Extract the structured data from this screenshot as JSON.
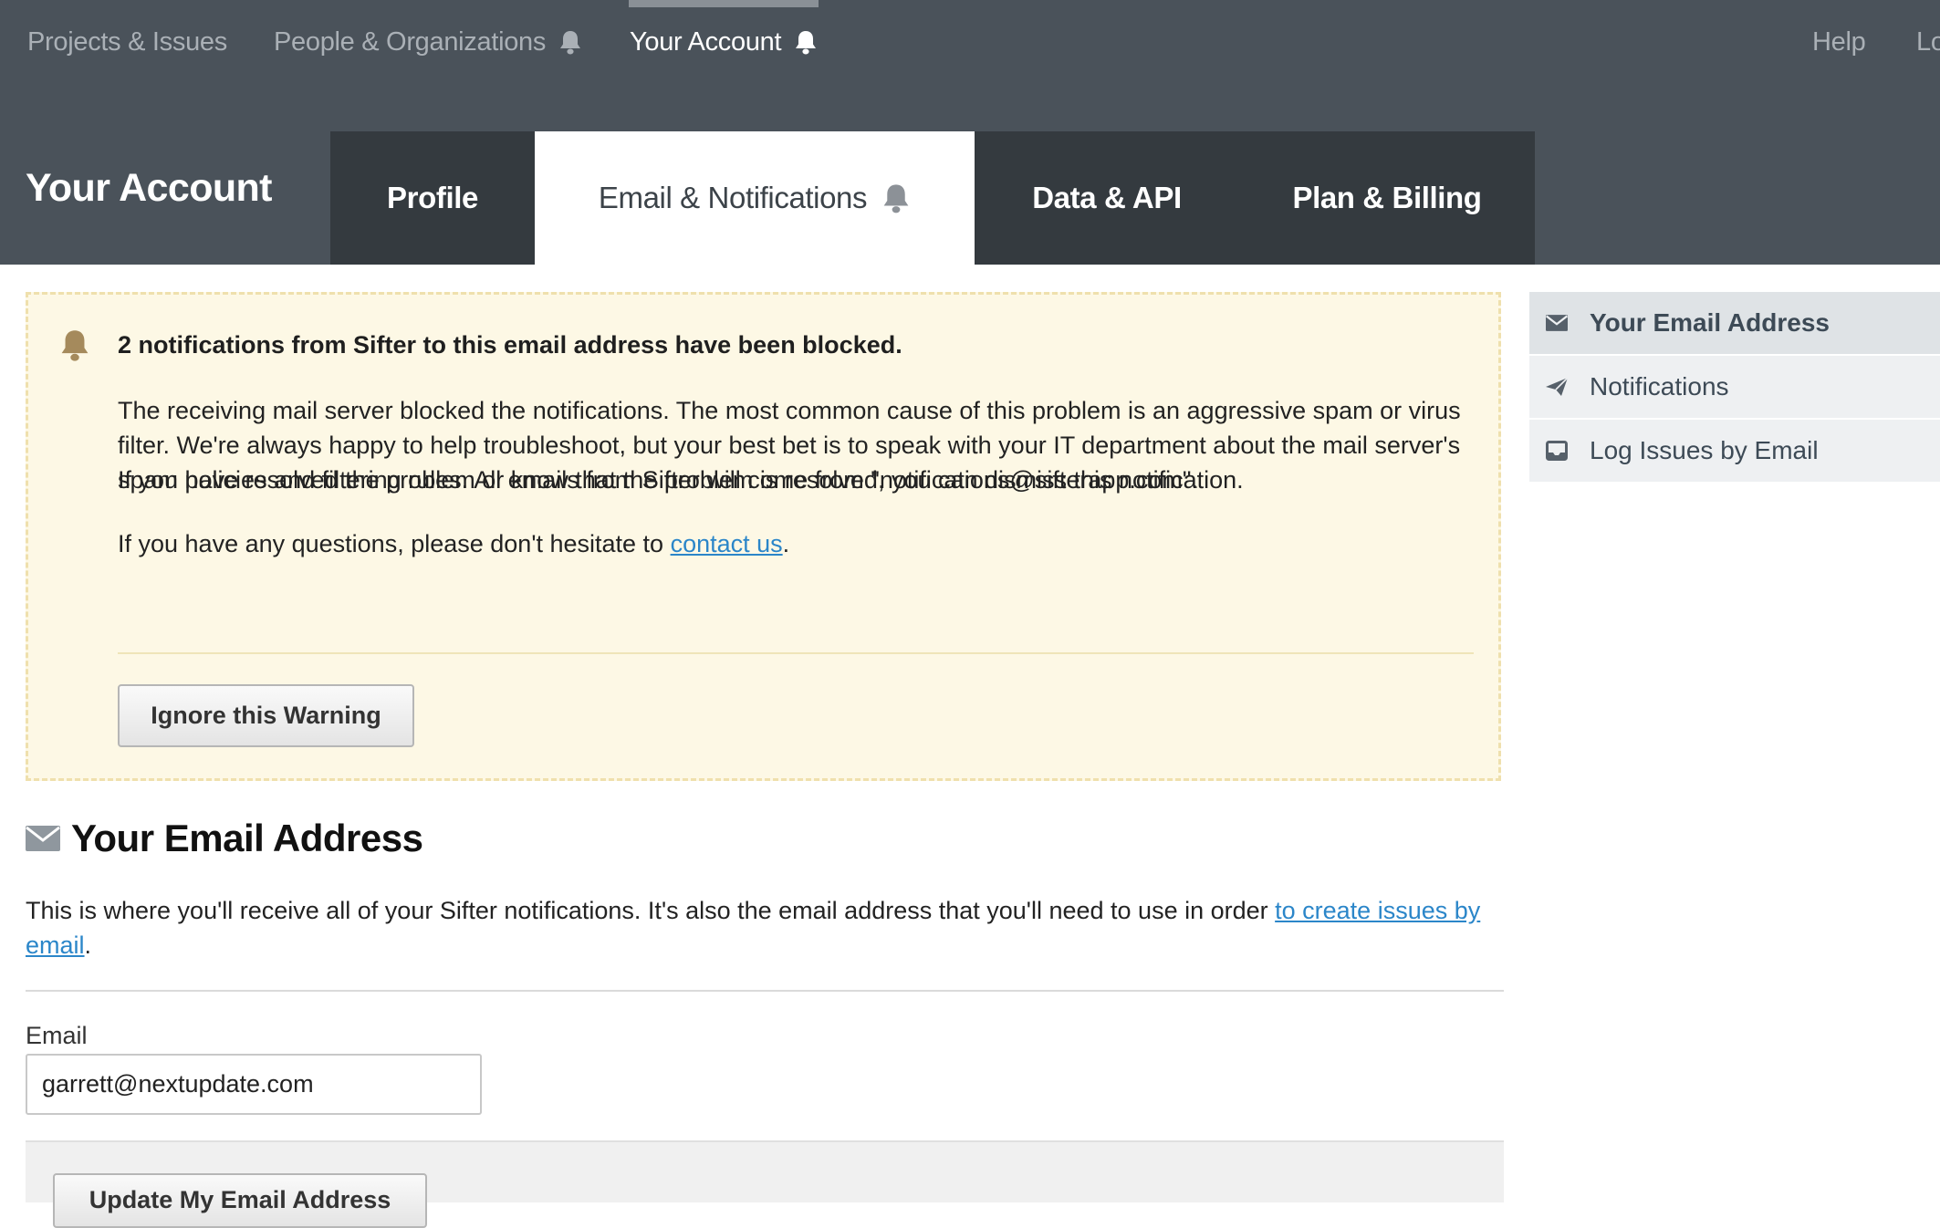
{
  "nav": {
    "items": [
      {
        "label": "Projects & Issues",
        "icon": ""
      },
      {
        "label": "People & Organizations",
        "icon": "bell-icon"
      },
      {
        "label": "Your Account",
        "icon": "bell-icon"
      }
    ],
    "help": "Help",
    "logout_partial": "Lo"
  },
  "header": {
    "title": "Your Account",
    "tabs": [
      {
        "label": "Profile"
      },
      {
        "label": "Email & Notifications",
        "icon": "bell-icon"
      },
      {
        "label": "Data & API"
      },
      {
        "label": "Plan & Billing"
      }
    ]
  },
  "warning": {
    "title": "2 notifications from Sifter to this email address have been blocked.",
    "p1": "The receiving mail server blocked the notifications. The most common cause of this problem is an aggressive spam or virus filter. We're always happy to help troubleshoot, but your best bet is to speak with your IT department about the mail server's spam policies and filtering rules. All emails from Sifter will come from \"notifications@sifterapp.com\".",
    "p2": "If you have resolved the problem or know that the problem is resolved, you can dismiss this notification.",
    "p3_before": "If you have any questions, please don't hesitate to ",
    "p3_link": "contact us",
    "p3_after": ".",
    "button": "Ignore this Warning"
  },
  "email_section": {
    "heading": "Your Email Address",
    "desc_before": "This is where you'll receive all of your Sifter notifications. It's also the email address that you'll need to use in order ",
    "desc_link": "to create issues by email",
    "desc_after": ".",
    "field_label": "Email",
    "email_value": "garrett@nextupdate.com",
    "submit": "Update My Email Address"
  },
  "sidebar": {
    "items": [
      {
        "label": "Your Email Address",
        "icon": "envelope-icon",
        "current": true
      },
      {
        "label": "Notifications",
        "icon": "paper-plane-icon",
        "current": false
      },
      {
        "label": "Log Issues by Email",
        "icon": "inbox-icon",
        "current": false
      }
    ]
  },
  "colors": {
    "topbar": "#4a525a",
    "tab_dark": "#343a3f",
    "warning_bg": "#fdf8e5",
    "link": "#2b86c9",
    "bell": "#a58a5c"
  }
}
